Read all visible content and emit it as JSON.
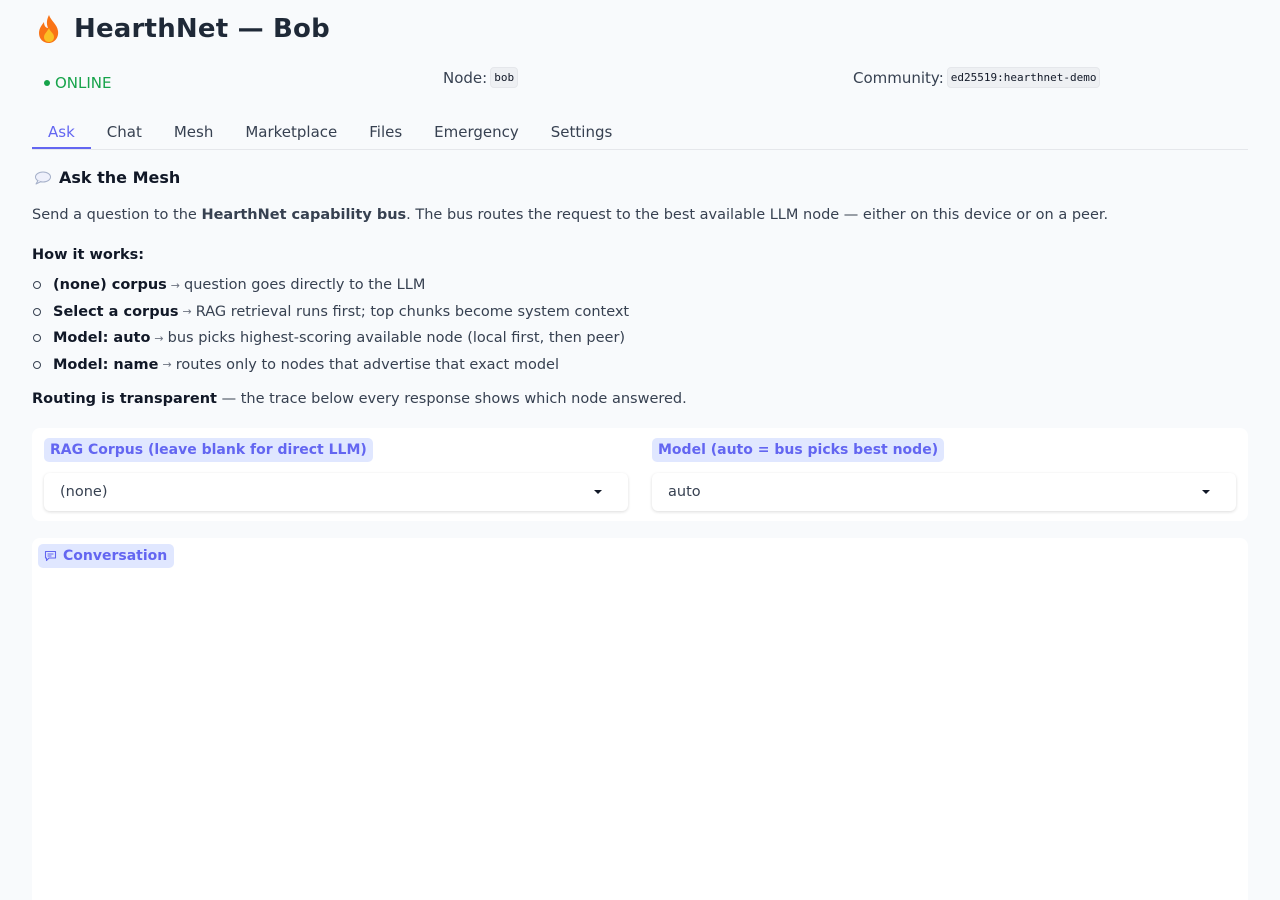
{
  "header": {
    "title": "HearthNet — Bob",
    "logo_icon": "flame-icon"
  },
  "status": {
    "online_text": "ONLINE",
    "online_color": "#16a34a",
    "node_label": "Node:",
    "node_value": "bob",
    "community_label": "Community:",
    "community_value": "ed25519:hearthnet-demo"
  },
  "tabs": [
    {
      "label": "Ask",
      "active": true
    },
    {
      "label": "Chat"
    },
    {
      "label": "Mesh"
    },
    {
      "label": "Marketplace"
    },
    {
      "label": "Files"
    },
    {
      "label": "Emergency"
    },
    {
      "label": "Settings"
    }
  ],
  "ask": {
    "title": "Ask the Mesh",
    "title_icon": "speech-bubble-icon",
    "intro": {
      "prefix": "Send a question to the ",
      "bold": "HearthNet capability bus",
      "suffix": ". The bus routes the request to the best available LLM node — either on this device or on a peer."
    },
    "how_label": "How it works:",
    "bullets": [
      {
        "bold": "(none) corpus",
        "text": "question goes directly to the LLM"
      },
      {
        "bold": "Select a corpus",
        "text": "RAG retrieval runs first; top chunks become system context"
      },
      {
        "bold": "Model: auto",
        "text": "bus picks highest-scoring available node (local first, then peer)"
      },
      {
        "bold": "Model: name",
        "text": "routes only to nodes that advertise that exact model"
      }
    ],
    "arrow": "→",
    "routing": {
      "bold": "Routing is transparent",
      "text": " — the trace below every response shows which node answered."
    },
    "corpus_field": {
      "label": "RAG Corpus (leave blank for direct LLM)",
      "value": "(none)"
    },
    "model_field": {
      "label": "Model (auto = bus picks best node)",
      "value": "auto"
    },
    "conversation": {
      "label": "Conversation",
      "icon": "chat-icon"
    }
  },
  "colors": {
    "accent": "#6366f1",
    "label_bg": "#e0e7ff",
    "background": "#f8fafc"
  }
}
